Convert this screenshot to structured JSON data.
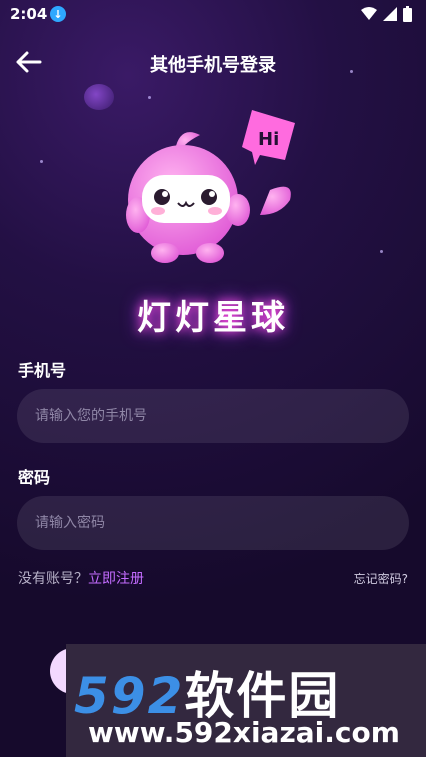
{
  "status": {
    "time": "2:04"
  },
  "header": {
    "title": "其他手机号登录"
  },
  "mascot": {
    "bubble_text": "Hi"
  },
  "brand": {
    "name": "灯灯星球"
  },
  "form": {
    "phone_label": "手机号",
    "phone_placeholder": "请输入您的手机号",
    "password_label": "密码",
    "password_placeholder": "请输入密码"
  },
  "links": {
    "no_account": "没有账号？",
    "register": "立即注册",
    "forgot": "忘记密码?"
  },
  "watermark": {
    "big_digits": "592",
    "big_cn": "软件园",
    "url": "www.592xiazai.com"
  },
  "colors": {
    "accent": "#c46cff",
    "brand_glow": "#ff4fd8",
    "watermark_blue": "#3c8fe6"
  }
}
